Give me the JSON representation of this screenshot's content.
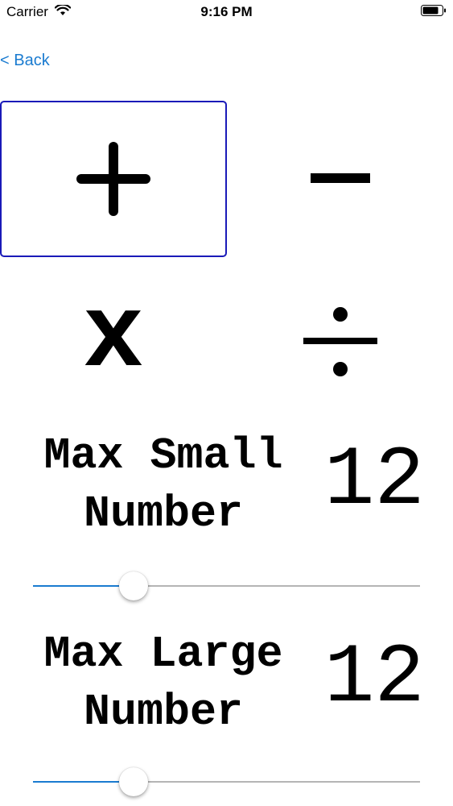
{
  "status_bar": {
    "carrier": "Carrier",
    "time": "9:16 PM"
  },
  "nav": {
    "back_label": "< Back"
  },
  "operations": [
    {
      "name": "add",
      "symbol": "+",
      "selected": true
    },
    {
      "name": "subtract",
      "symbol": "−",
      "selected": false
    },
    {
      "name": "multiply",
      "symbol": "x",
      "selected": false
    },
    {
      "name": "divide",
      "symbol": "÷",
      "selected": false
    }
  ],
  "max_small": {
    "label": "Max Small\nNumber",
    "value": "12",
    "slider_fraction": 0.26
  },
  "max_large": {
    "label": "Max Large\nNumber",
    "value": "12",
    "slider_fraction": 0.26
  },
  "colors": {
    "accent": "#1a7bd0",
    "selection_border": "#1a1ab8",
    "track": "#b5b5b5"
  }
}
